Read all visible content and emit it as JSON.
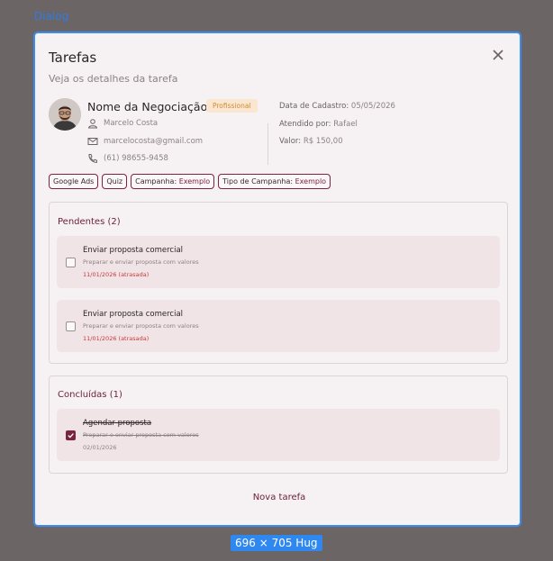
{
  "frame_label": "Dialog",
  "size_badge": "696 × 705 Hug",
  "dialog": {
    "title": "Tarefas",
    "subtitle": "Veja os detalhes da tarefa"
  },
  "deal": {
    "name": "Nome da Negociação",
    "tier": "Profissional",
    "contact_name": "Marcelo Costa",
    "email": "marcelocosta@gmail.com",
    "phone": "(61) 98655-9458"
  },
  "meta": {
    "created_label": "Data de Cadastro:",
    "created_value": "05/05/2026",
    "attended_label": "Atendido por:",
    "attended_value": "Rafael",
    "value_label": "Valor:",
    "value_value": "R$ 150,00"
  },
  "tags": [
    {
      "label": "Google Ads",
      "value": ""
    },
    {
      "label": "Quiz",
      "value": ""
    },
    {
      "label": "Campanha:",
      "value": "Exemplo"
    },
    {
      "label": "Tipo de Campanha:",
      "value": "Exemplo"
    }
  ],
  "pending": {
    "title": "Pendentes (2)",
    "tasks": [
      {
        "title": "Enviar proposta comercial",
        "desc": "Preparar e enviar proposta com valores",
        "date": "11/01/2026 (atrasada)"
      },
      {
        "title": "Enviar proposta comercial",
        "desc": "Preparar e enviar proposta com valores",
        "date": "11/01/2026 (atrasada)"
      }
    ]
  },
  "done": {
    "title": "Concluídas (1)",
    "tasks": [
      {
        "title": "Agendar proposta",
        "desc": "Preparar e enviar proposta com valores",
        "date": "02/01/2026"
      }
    ]
  },
  "new_task_label": "Nova tarefa",
  "colors": {
    "accent": "#7a2440",
    "task_bg": "#f0e4e7",
    "overdue": "#c93a3a",
    "selection": "#3b8cf1"
  }
}
